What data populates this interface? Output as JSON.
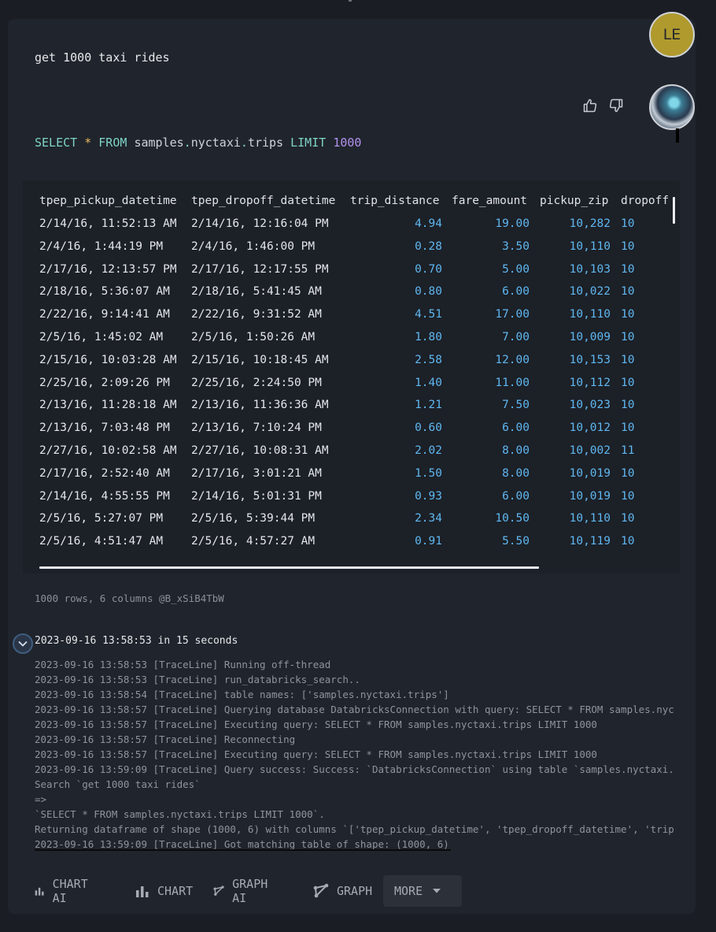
{
  "user": {
    "avatar_initials": "LE",
    "query": "get 1000 taxi rides"
  },
  "response": {
    "sql": {
      "select": "SELECT",
      "star": "*",
      "from": "FROM",
      "schema": "samples",
      "dot1": ".",
      "db": "nyctaxi",
      "dot2": ".",
      "table": "trips",
      "limit": "LIMIT",
      "limit_n": "1000"
    },
    "table": {
      "columns": [
        "tpep_pickup_datetime",
        "tpep_dropoff_datetime",
        "trip_distance",
        "fare_amount",
        "pickup_zip",
        "dropoff"
      ],
      "rows": [
        [
          "2/14/16, 11:52:13 AM",
          "2/14/16, 12:16:04 PM",
          "4.94",
          "19.00",
          "10,282",
          "10"
        ],
        [
          "2/4/16, 1:44:19 PM",
          "2/4/16, 1:46:00 PM",
          "0.28",
          "3.50",
          "10,110",
          "10"
        ],
        [
          "2/17/16, 12:13:57 PM",
          "2/17/16, 12:17:55 PM",
          "0.70",
          "5.00",
          "10,103",
          "10"
        ],
        [
          "2/18/16, 5:36:07 AM",
          "2/18/16, 5:41:45 AM",
          "0.80",
          "6.00",
          "10,022",
          "10"
        ],
        [
          "2/22/16, 9:14:41 AM",
          "2/22/16, 9:31:52 AM",
          "4.51",
          "17.00",
          "10,110",
          "10"
        ],
        [
          "2/5/16, 1:45:02 AM",
          "2/5/16, 1:50:26 AM",
          "1.80",
          "7.00",
          "10,009",
          "10"
        ],
        [
          "2/15/16, 10:03:28 AM",
          "2/15/16, 10:18:45 AM",
          "2.58",
          "12.00",
          "10,153",
          "10"
        ],
        [
          "2/25/16, 2:09:26 PM",
          "2/25/16, 2:24:50 PM",
          "1.40",
          "11.00",
          "10,112",
          "10"
        ],
        [
          "2/13/16, 11:28:18 AM",
          "2/13/16, 11:36:36 AM",
          "1.21",
          "7.50",
          "10,023",
          "10"
        ],
        [
          "2/13/16, 7:03:48 PM",
          "2/13/16, 7:10:24 PM",
          "0.60",
          "6.00",
          "10,012",
          "10"
        ],
        [
          "2/27/16, 10:02:58 AM",
          "2/27/16, 10:08:31 AM",
          "2.02",
          "8.00",
          "10,002",
          "11"
        ],
        [
          "2/17/16, 2:52:40 AM",
          "2/17/16, 3:01:21 AM",
          "1.50",
          "8.00",
          "10,019",
          "10"
        ],
        [
          "2/14/16, 4:55:55 PM",
          "2/14/16, 5:01:31 PM",
          "0.93",
          "6.00",
          "10,019",
          "10"
        ],
        [
          "2/5/16, 5:27:07 PM",
          "2/5/16, 5:39:44 PM",
          "2.34",
          "10.50",
          "10,110",
          "10"
        ],
        [
          "2/5/16, 4:51:47 AM",
          "2/5/16, 4:57:27 AM",
          "0.91",
          "5.50",
          "10,119",
          "10"
        ]
      ]
    },
    "meta": "1000 rows, 6 columns @B_xSiB4TbW",
    "trace_header": "2023-09-16 13:58:53 in 15 seconds",
    "log_lines": [
      "2023-09-16 13:58:53 [TraceLine] Running off-thread",
      "2023-09-16 13:58:53 [TraceLine] run_databricks_search..",
      "2023-09-16 13:58:54 [TraceLine] table names: ['samples.nyctaxi.trips']",
      "2023-09-16 13:58:57 [TraceLine] Querying database DatabricksConnection with query: SELECT * FROM samples.nyc",
      "2023-09-16 13:58:57 [TraceLine] Executing query: SELECT * FROM samples.nyctaxi.trips LIMIT 1000",
      "2023-09-16 13:58:57 [TraceLine] Reconnecting",
      "2023-09-16 13:58:57 [TraceLine] Executing query: SELECT * FROM samples.nyctaxi.trips LIMIT 1000",
      "2023-09-16 13:59:09 [TraceLine] Query success: Success: `DatabricksConnection` using table `samples.nyctaxi.",
      "Search `get 1000 taxi rides`",
      "=>",
      "`SELECT * FROM samples.nyctaxi.trips LIMIT 1000`.",
      "Returning dataframe of shape (1000, 6) with columns `['tpep_pickup_datetime', 'tpep_dropoff_datetime', 'trip",
      "2023-09-16 13:59:09 [TraceLine] Got matching table of shape: (1000, 6)"
    ]
  },
  "toolbar": {
    "chart_ai": "CHART AI",
    "chart": "CHART",
    "graph_ai": "GRAPH AI",
    "graph": "GRAPH",
    "more": "MORE"
  },
  "icons": {
    "thumbs_up": "thumbs-up-icon",
    "thumbs_down": "thumbs-down-icon",
    "bar_chart": "bar-chart-icon",
    "graph": "graph-icon",
    "caret_down": "caret-down-icon",
    "chevron_down": "chevron-down-icon"
  },
  "colors": {
    "background": "#1a1d23",
    "card": "#20242c",
    "number": "#5fb7f0",
    "keyword": "#7fd4c8",
    "operator": "#e8b75f",
    "literal": "#b392f0"
  }
}
